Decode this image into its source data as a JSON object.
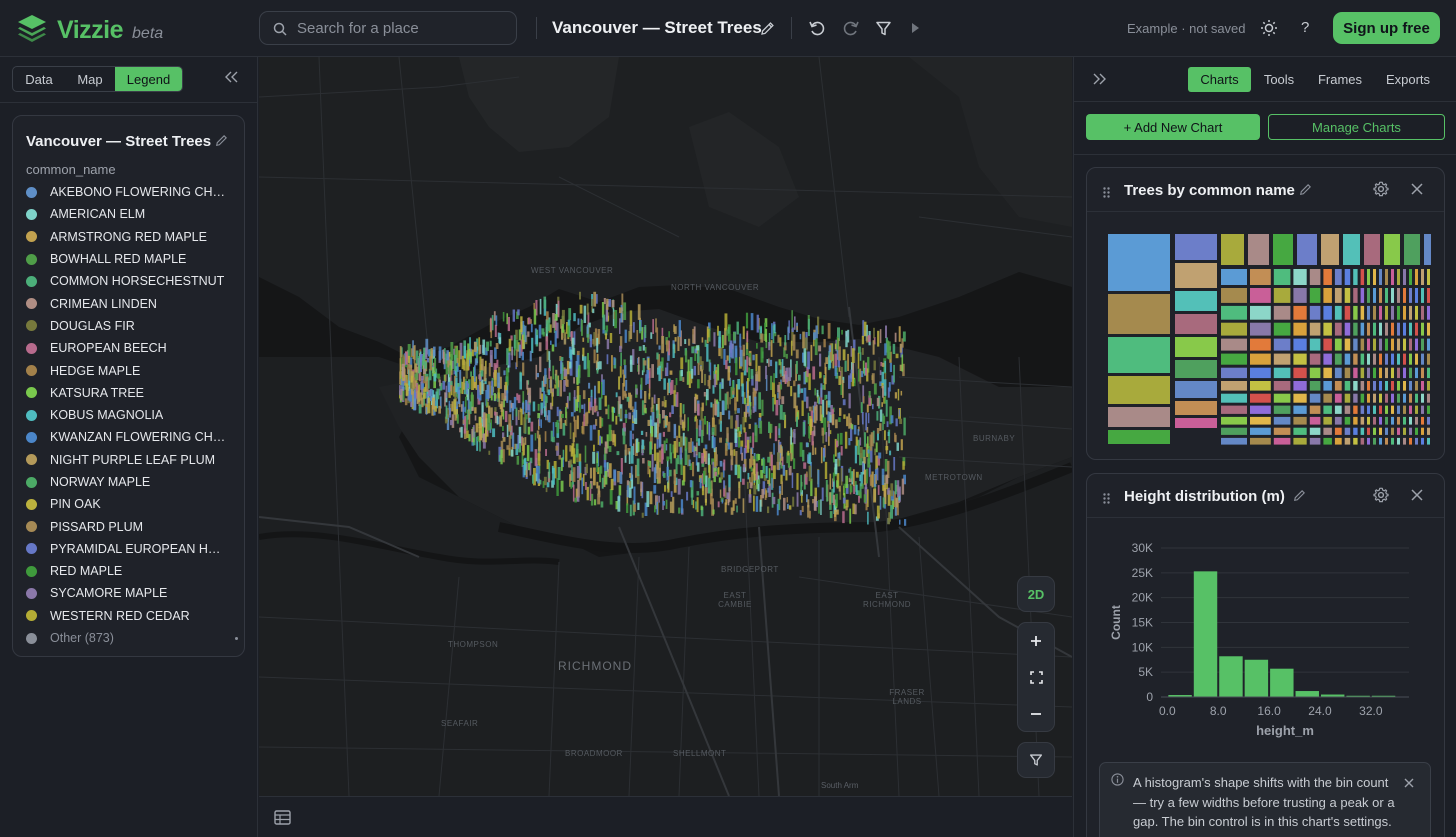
{
  "app": {
    "name": "Vizzie",
    "badge": "beta",
    "accent": "#57c166"
  },
  "header": {
    "search_placeholder": "Search for a place",
    "doc_title": "Vancouver — Street Trees",
    "status": "Example · not saved",
    "help": "?",
    "signup": "Sign up free",
    "icons": [
      "search-icon",
      "edit-pencil-icon",
      "undo-icon",
      "redo-icon",
      "filter-icon",
      "play-icon",
      "theme-sun-icon",
      "help-icon"
    ]
  },
  "left_panel": {
    "tabs": [
      {
        "label": "Data",
        "active": false
      },
      {
        "label": "Map",
        "active": false
      },
      {
        "label": "Legend",
        "active": true
      }
    ],
    "legend": {
      "title": "Vancouver — Street Trees",
      "field": "common_name",
      "items": [
        {
          "label": "AKEBONO FLOWERING CHE...",
          "color": "#5f8fc7"
        },
        {
          "label": "AMERICAN ELM",
          "color": "#7fd3c9"
        },
        {
          "label": "ARMSTRONG RED MAPLE",
          "color": "#c2a24f"
        },
        {
          "label": "BOWHALL RED MAPLE",
          "color": "#4f9e48"
        },
        {
          "label": "COMMON HORSECHESTNUT",
          "color": "#4caf7a"
        },
        {
          "label": "CRIMEAN LINDEN",
          "color": "#b08e84"
        },
        {
          "label": "DOUGLAS FIR",
          "color": "#77793c"
        },
        {
          "label": "EUROPEAN BEECH",
          "color": "#b86b8d"
        },
        {
          "label": "HEDGE MAPLE",
          "color": "#a3814a"
        },
        {
          "label": "KATSURA TREE",
          "color": "#7ac94d"
        },
        {
          "label": "KOBUS MAGNOLIA",
          "color": "#4fbcc0"
        },
        {
          "label": "KWANZAN FLOWERING CHE...",
          "color": "#4b86c9"
        },
        {
          "label": "NIGHT PURPLE LEAF PLUM",
          "color": "#b49a5a"
        },
        {
          "label": "NORWAY MAPLE",
          "color": "#4caa66"
        },
        {
          "label": "PIN OAK",
          "color": "#bcb23e"
        },
        {
          "label": "PISSARD PLUM",
          "color": "#a68a55"
        },
        {
          "label": "PYRAMIDAL EUROPEAN HOR...",
          "color": "#6678c7"
        },
        {
          "label": "RED MAPLE",
          "color": "#3f9a3c"
        },
        {
          "label": "SYCAMORE MAPLE",
          "color": "#8b78a9"
        },
        {
          "label": "WESTERN RED CEDAR",
          "color": "#b4ac35"
        }
      ],
      "other_label": "Other (873)",
      "other_color": "#8a8f99"
    }
  },
  "map": {
    "labels": {
      "west_vancouver": "WEST VANCOUVER",
      "north_vancouver": "NORTH VANCOUVER",
      "burnaby": "BURNABY",
      "metrotown": "METROTOWN",
      "bridgeport": "BRIDGEPORT",
      "east_cambie": "EAST CAMBIE",
      "east_richmond": "EAST RICHMOND",
      "thompson": "THOMPSON",
      "richmond": "RICHMOND",
      "seafair": "SEAFAIR",
      "broadmoor": "BROADMOOR",
      "shellmont": "SHELLMONT",
      "fraser_lands": "FRASER LANDS"
    },
    "view_mode_button": "2D",
    "attribution": "South Arm"
  },
  "right_panel": {
    "tabs": [
      {
        "label": "Charts",
        "active": true
      },
      {
        "label": "Tools",
        "active": false
      },
      {
        "label": "Frames",
        "active": false
      },
      {
        "label": "Exports",
        "active": false
      }
    ],
    "add_chart": "+ Add New Chart",
    "manage_charts": "Manage Charts",
    "cards": [
      {
        "title": "Trees by common name",
        "kind": "treemap"
      },
      {
        "title": "Height distribution (m)",
        "kind": "histogram"
      }
    ],
    "info_note": "A histogram's shape shifts with the bin count — try a few widths before trusting a peak or a gap. The bin control is in this chart's settings."
  },
  "chart_data": {
    "type": "bar",
    "xlabel": "height_m",
    "ylabel": "Count",
    "x_tick_labels": [
      "0.0",
      "8.0",
      "16.0",
      "24.0",
      "32.0"
    ],
    "y_tick_labels": [
      "0",
      "5K",
      "10K",
      "15K",
      "20K",
      "25K",
      "30K"
    ],
    "ylim": [
      0,
      30000
    ],
    "xlim": [
      -1,
      38
    ],
    "bin_width": 4,
    "bins_start": [
      0,
      4,
      8,
      12,
      16,
      20,
      24,
      28,
      32
    ],
    "values": [
      400,
      25300,
      8200,
      7500,
      5700,
      1200,
      500,
      250,
      250
    ],
    "bar_color": "#57c166",
    "grid": true
  }
}
